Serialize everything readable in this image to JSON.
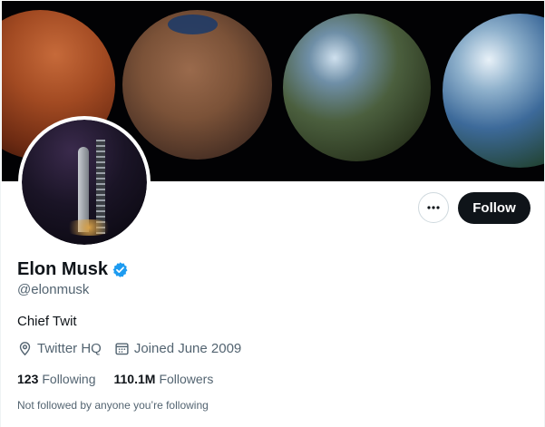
{
  "profile": {
    "name": "Elon Musk",
    "handle": "@elonmusk",
    "bio": "Chief Twit",
    "location": "Twitter HQ",
    "joined": "Joined June 2009",
    "following_count": "123",
    "following_label": "Following",
    "followers_count": "110.1M",
    "followers_label": "Followers",
    "not_followed_text": "Not followed by anyone you’re following"
  },
  "actions": {
    "follow_label": "Follow",
    "more_icon": "more-icon"
  },
  "icons": {
    "verified": "verified-badge-icon",
    "location": "location-pin-icon",
    "calendar": "calendar-icon"
  },
  "colors": {
    "verified": "#1d9bf0",
    "follow_bg": "#0f1419",
    "secondary_text": "#536471"
  }
}
